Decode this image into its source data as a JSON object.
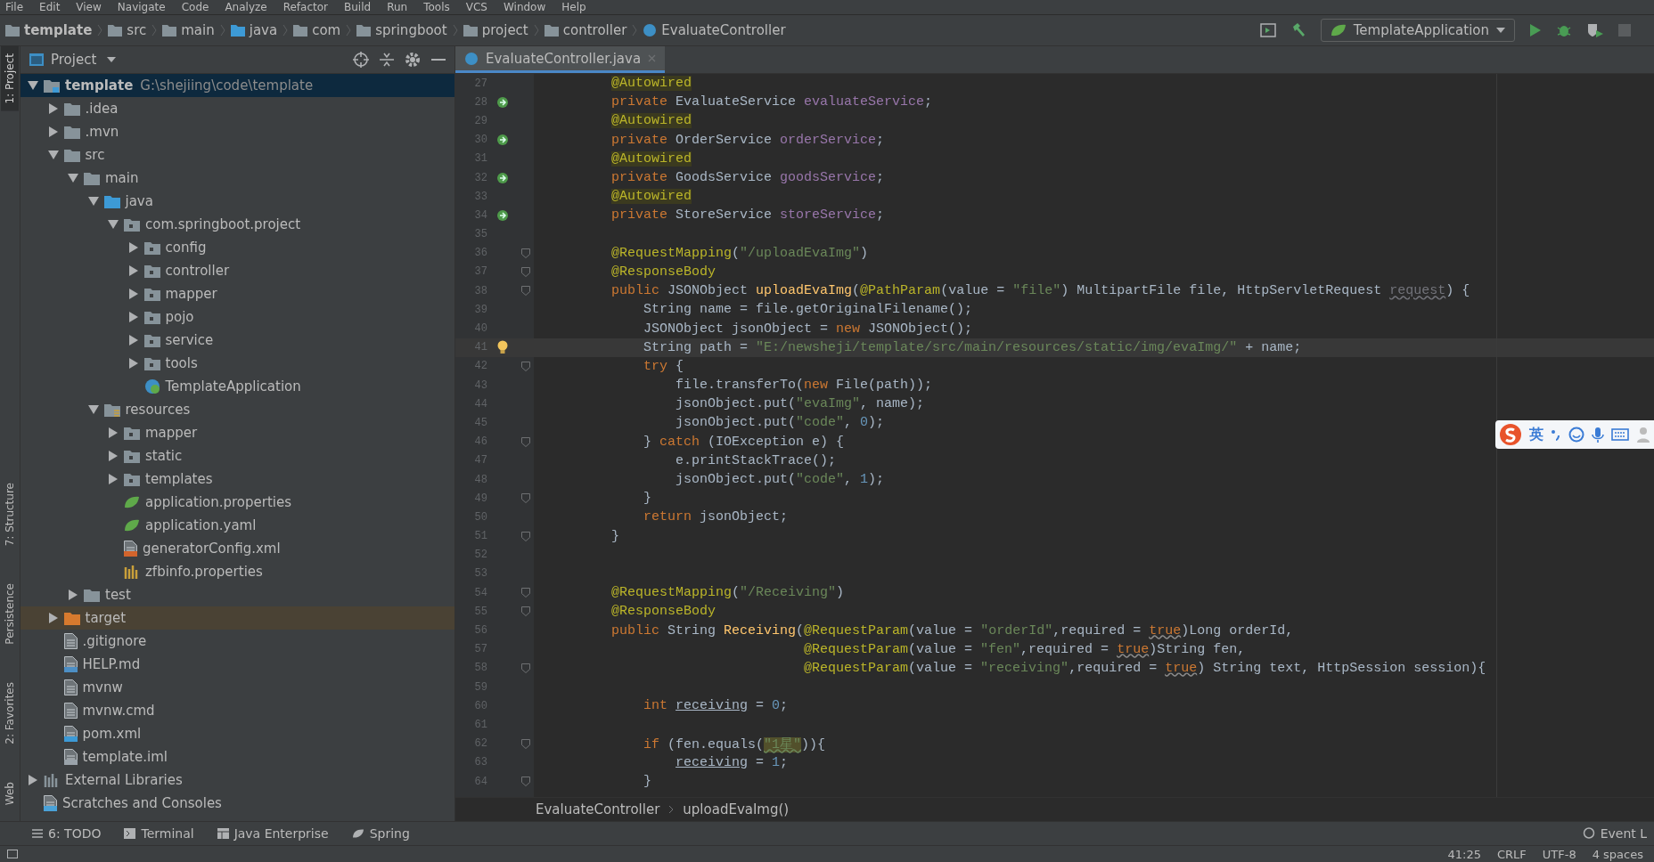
{
  "menu": [
    "File",
    "Edit",
    "View",
    "Navigate",
    "Code",
    "Analyze",
    "Refactor",
    "Build",
    "Run",
    "Tools",
    "VCS",
    "Window",
    "Help"
  ],
  "breadcrumb": [
    {
      "label": "template",
      "kind": "module"
    },
    {
      "label": "src",
      "kind": "folder"
    },
    {
      "label": "main",
      "kind": "folder"
    },
    {
      "label": "java",
      "kind": "source"
    },
    {
      "label": "com",
      "kind": "package"
    },
    {
      "label": "springboot",
      "kind": "package"
    },
    {
      "label": "project",
      "kind": "package"
    },
    {
      "label": "controller",
      "kind": "package"
    },
    {
      "label": "EvaluateController",
      "kind": "class"
    }
  ],
  "run_configuration": {
    "label": "TemplateApplication"
  },
  "side_tabs": [
    {
      "label": "1: Project",
      "selected": true
    },
    {
      "label": "7: Structure",
      "selected": false
    },
    {
      "label": "Persistence",
      "selected": false
    },
    {
      "label": "2: Favorites",
      "selected": false
    },
    {
      "label": "Web",
      "selected": false
    }
  ],
  "project_panel": {
    "title": "Project",
    "tree": [
      {
        "label": "template",
        "location": "G:\\shejiing\\code\\template",
        "kind": "module",
        "expanded": true,
        "selected": true,
        "children": [
          {
            "label": ".idea",
            "kind": "folder",
            "expanded": false,
            "selected": false
          },
          {
            "label": ".mvn",
            "kind": "folder",
            "expanded": false,
            "selected": false
          },
          {
            "label": "src",
            "kind": "folder",
            "expanded": true,
            "selected": false,
            "children": [
              {
                "label": "main",
                "kind": "folder",
                "expanded": true,
                "selected": false,
                "children": [
                  {
                    "label": "java",
                    "kind": "source",
                    "expanded": true,
                    "selected": false,
                    "children": [
                      {
                        "label": "com.springboot.project",
                        "kind": "package",
                        "expanded": true,
                        "selected": false,
                        "children": [
                          {
                            "label": "config",
                            "kind": "package",
                            "expanded": false,
                            "selected": false
                          },
                          {
                            "label": "controller",
                            "kind": "package",
                            "expanded": false,
                            "selected": false
                          },
                          {
                            "label": "mapper",
                            "kind": "package",
                            "expanded": false,
                            "selected": false
                          },
                          {
                            "label": "pojo",
                            "kind": "package",
                            "expanded": false,
                            "selected": false
                          },
                          {
                            "label": "service",
                            "kind": "package",
                            "expanded": false,
                            "selected": false
                          },
                          {
                            "label": "tools",
                            "kind": "package",
                            "expanded": false,
                            "selected": false
                          },
                          {
                            "label": "TemplateApplication",
                            "kind": "spring-class",
                            "selected": false
                          }
                        ]
                      }
                    ]
                  },
                  {
                    "label": "resources",
                    "kind": "resources",
                    "expanded": true,
                    "selected": false,
                    "children": [
                      {
                        "label": "mapper",
                        "kind": "package",
                        "expanded": false,
                        "selected": false
                      },
                      {
                        "label": "static",
                        "kind": "package",
                        "expanded": false,
                        "selected": false
                      },
                      {
                        "label": "templates",
                        "kind": "package",
                        "expanded": false,
                        "selected": false
                      },
                      {
                        "label": "application.properties",
                        "kind": "spring-config",
                        "selected": false
                      },
                      {
                        "label": "application.yaml",
                        "kind": "spring-config",
                        "selected": false
                      },
                      {
                        "label": "generatorConfig.xml",
                        "kind": "xml",
                        "selected": false
                      },
                      {
                        "label": "zfbinfo.properties",
                        "kind": "properties",
                        "selected": false
                      }
                    ]
                  }
                ]
              },
              {
                "label": "test",
                "kind": "folder",
                "expanded": false,
                "selected": false
              }
            ]
          },
          {
            "label": "target",
            "kind": "excluded",
            "expanded": false,
            "selected": false
          },
          {
            "label": ".gitignore",
            "kind": "file",
            "selected": false
          },
          {
            "label": "HELP.md",
            "kind": "markdown",
            "selected": false
          },
          {
            "label": "mvnw",
            "kind": "file",
            "selected": false
          },
          {
            "label": "mvnw.cmd",
            "kind": "file",
            "selected": false
          },
          {
            "label": "pom.xml",
            "kind": "maven",
            "selected": false
          },
          {
            "label": "template.iml",
            "kind": "iml",
            "selected": false
          }
        ]
      },
      {
        "label": "External Libraries",
        "kind": "libraries",
        "expanded": false,
        "selected": false
      },
      {
        "label": "Scratches and Consoles",
        "kind": "scratches",
        "selected": false
      }
    ]
  },
  "editor": {
    "tabs": [
      {
        "label": "EvaluateController.java",
        "selected": true
      }
    ],
    "lines": [
      {
        "number": "27",
        "tokens": [
          {
            "kind": "annotation-hl",
            "text": "    @Autowired"
          }
        ]
      },
      {
        "number": "28",
        "kind": "bean",
        "tokens": [
          {
            "kind": "keyword",
            "text": "    private "
          },
          {
            "kind": "plain",
            "text": "EvaluateService "
          },
          {
            "kind": "field",
            "text": "evaluateService"
          },
          {
            "kind": "plain",
            "text": ";"
          }
        ]
      },
      {
        "number": "29",
        "tokens": [
          {
            "kind": "annotation-hl",
            "text": "    @Autowired"
          }
        ]
      },
      {
        "number": "30",
        "kind": "bean",
        "tokens": [
          {
            "kind": "keyword",
            "text": "    private "
          },
          {
            "kind": "plain",
            "text": "OrderService "
          },
          {
            "kind": "field",
            "text": "orderService"
          },
          {
            "kind": "plain",
            "text": ";"
          }
        ]
      },
      {
        "number": "31",
        "tokens": [
          {
            "kind": "annotation-hl",
            "text": "    @Autowired"
          }
        ]
      },
      {
        "number": "32",
        "kind": "bean",
        "tokens": [
          {
            "kind": "keyword",
            "text": "    private "
          },
          {
            "kind": "plain",
            "text": "GoodsService "
          },
          {
            "kind": "field",
            "text": "goodsService"
          },
          {
            "kind": "plain",
            "text": ";"
          }
        ]
      },
      {
        "number": "33",
        "tokens": [
          {
            "kind": "annotation-hl",
            "text": "    @Autowired"
          }
        ]
      },
      {
        "number": "34",
        "kind": "bean",
        "tokens": [
          {
            "kind": "keyword",
            "text": "    private "
          },
          {
            "kind": "plain",
            "text": "StoreService "
          },
          {
            "kind": "field",
            "text": "storeService"
          },
          {
            "kind": "plain",
            "text": ";"
          }
        ]
      },
      {
        "number": "35"
      },
      {
        "number": "36",
        "kind": "fold",
        "tokens": [
          {
            "kind": "annotation",
            "text": "    @RequestMapping"
          },
          {
            "kind": "plain",
            "text": "("
          },
          {
            "kind": "string",
            "text": "\"/uploadEvaImg\""
          },
          {
            "kind": "plain",
            "text": ")"
          }
        ]
      },
      {
        "number": "37",
        "kind": "fold",
        "tokens": [
          {
            "kind": "annotation",
            "text": "    @ResponseBody"
          }
        ]
      },
      {
        "number": "38",
        "kind": "fold",
        "tokens": [
          {
            "kind": "keyword",
            "text": "    public "
          },
          {
            "kind": "plain",
            "text": "JSONObject "
          },
          {
            "kind": "method",
            "text": "uploadEvaImg"
          },
          {
            "kind": "plain",
            "text": "("
          },
          {
            "kind": "annotation",
            "text": "@PathParam"
          },
          {
            "kind": "plain",
            "text": "(value = "
          },
          {
            "kind": "string",
            "text": "\"file\""
          },
          {
            "kind": "plain",
            "text": ") MultipartFile file, HttpServletRequest "
          },
          {
            "kind": "unused",
            "text": "request"
          },
          {
            "kind": "plain",
            "text": ") {"
          }
        ]
      },
      {
        "number": "39",
        "tokens": [
          {
            "kind": "plain",
            "text": "        String name = file.getOriginalFilename();"
          }
        ]
      },
      {
        "number": "40",
        "tokens": [
          {
            "kind": "plain",
            "text": "        JSONObject jsonObject = "
          },
          {
            "kind": "keyword",
            "text": "new "
          },
          {
            "kind": "plain",
            "text": "JSONObject();"
          }
        ]
      },
      {
        "number": "41",
        "kind": "bulb",
        "current": true,
        "tokens": [
          {
            "kind": "plain",
            "text": "        String path = "
          },
          {
            "kind": "string",
            "text": "\"E:/newsheji/template/src/main/resources/static/img/evaImg/\""
          },
          {
            "kind": "plain",
            "text": " + name;"
          }
        ]
      },
      {
        "number": "42",
        "kind": "fold",
        "tokens": [
          {
            "kind": "keyword",
            "text": "        try"
          },
          {
            "kind": "plain",
            "text": " {"
          }
        ]
      },
      {
        "number": "43",
        "tokens": [
          {
            "kind": "plain",
            "text": "            file.transferTo("
          },
          {
            "kind": "keyword",
            "text": "new "
          },
          {
            "kind": "plain",
            "text": "File(path));"
          }
        ]
      },
      {
        "number": "44",
        "tokens": [
          {
            "kind": "plain",
            "text": "            jsonObject.put("
          },
          {
            "kind": "string",
            "text": "\"evaImg\""
          },
          {
            "kind": "plain",
            "text": ", name);"
          }
        ]
      },
      {
        "number": "45",
        "tokens": [
          {
            "kind": "plain",
            "text": "            jsonObject.put("
          },
          {
            "kind": "string",
            "text": "\"code\""
          },
          {
            "kind": "plain",
            "text": ", "
          },
          {
            "kind": "number",
            "text": "0"
          },
          {
            "kind": "plain",
            "text": ");"
          }
        ]
      },
      {
        "number": "46",
        "kind": "fold",
        "tokens": [
          {
            "kind": "plain",
            "text": "        } "
          },
          {
            "kind": "keyword",
            "text": "catch"
          },
          {
            "kind": "plain",
            "text": " (IOException e) {"
          }
        ]
      },
      {
        "number": "47",
        "tokens": [
          {
            "kind": "plain",
            "text": "            e.printStackTrace();"
          }
        ]
      },
      {
        "number": "48",
        "tokens": [
          {
            "kind": "plain",
            "text": "            jsonObject.put("
          },
          {
            "kind": "string",
            "text": "\"code\""
          },
          {
            "kind": "plain",
            "text": ", "
          },
          {
            "kind": "number",
            "text": "1"
          },
          {
            "kind": "plain",
            "text": ");"
          }
        ]
      },
      {
        "number": "49",
        "kind": "fold",
        "tokens": [
          {
            "kind": "plain",
            "text": "        }"
          }
        ]
      },
      {
        "number": "50",
        "tokens": [
          {
            "kind": "keyword",
            "text": "        return "
          },
          {
            "kind": "plain",
            "text": "jsonObject;"
          }
        ]
      },
      {
        "number": "51",
        "kind": "fold",
        "tokens": [
          {
            "kind": "plain",
            "text": "    }"
          }
        ]
      },
      {
        "number": "52"
      },
      {
        "number": "53"
      },
      {
        "number": "54",
        "kind": "fold",
        "tokens": [
          {
            "kind": "annotation",
            "text": "    @RequestMapping"
          },
          {
            "kind": "plain",
            "text": "("
          },
          {
            "kind": "string",
            "text": "\"/Receiving\""
          },
          {
            "kind": "plain",
            "text": ")"
          }
        ]
      },
      {
        "number": "55",
        "kind": "fold",
        "tokens": [
          {
            "kind": "annotation",
            "text": "    @ResponseBody"
          }
        ]
      },
      {
        "number": "56",
        "tokens": [
          {
            "kind": "keyword",
            "text": "    public "
          },
          {
            "kind": "plain",
            "text": "String "
          },
          {
            "kind": "method",
            "text": "Receiving"
          },
          {
            "kind": "plain",
            "text": "("
          },
          {
            "kind": "annotation",
            "text": "@RequestParam"
          },
          {
            "kind": "plain",
            "text": "(value = "
          },
          {
            "kind": "string",
            "text": "\"orderId\""
          },
          {
            "kind": "plain",
            "text": ",required = "
          },
          {
            "kind": "flagged-keyword",
            "text": "true"
          },
          {
            "kind": "plain",
            "text": ")Long orderId,"
          }
        ]
      },
      {
        "number": "57",
        "tokens": [
          {
            "kind": "annotation",
            "text": "                            @RequestParam"
          },
          {
            "kind": "plain",
            "text": "(value = "
          },
          {
            "kind": "string",
            "text": "\"fen\""
          },
          {
            "kind": "plain",
            "text": ",required = "
          },
          {
            "kind": "flagged-keyword",
            "text": "true"
          },
          {
            "kind": "plain",
            "text": ")String fen,"
          }
        ]
      },
      {
        "number": "58",
        "kind": "fold",
        "tokens": [
          {
            "kind": "annotation",
            "text": "                            @RequestParam"
          },
          {
            "kind": "plain",
            "text": "(value = "
          },
          {
            "kind": "string",
            "text": "\"receiving\""
          },
          {
            "kind": "plain",
            "text": ",required = "
          },
          {
            "kind": "flagged-keyword",
            "text": "true"
          },
          {
            "kind": "plain",
            "text": ") String text, HttpSession session){"
          }
        ]
      },
      {
        "number": "59"
      },
      {
        "number": "60",
        "tokens": [
          {
            "kind": "keyword",
            "text": "        int "
          },
          {
            "kind": "reassigned",
            "text": "receiving"
          },
          {
            "kind": "plain",
            "text": " = "
          },
          {
            "kind": "number",
            "text": "0"
          },
          {
            "kind": "plain",
            "text": ";"
          }
        ]
      },
      {
        "number": "61"
      },
      {
        "number": "62",
        "kind": "fold",
        "tokens": [
          {
            "kind": "keyword",
            "text": "        if"
          },
          {
            "kind": "plain",
            "text": " (fen.equals("
          },
          {
            "kind": "string-hl",
            "text": "\"1星\""
          },
          {
            "kind": "plain",
            "text": ")){"
          }
        ]
      },
      {
        "number": "63",
        "tokens": [
          {
            "kind": "reassigned",
            "text": "            receiving"
          },
          {
            "kind": "plain",
            "text": " = "
          },
          {
            "kind": "number",
            "text": "1"
          },
          {
            "kind": "plain",
            "text": ";"
          }
        ]
      },
      {
        "number": "64",
        "kind": "fold",
        "tokens": [
          {
            "kind": "plain",
            "text": "        }"
          }
        ]
      }
    ],
    "crumbs": [
      "EvaluateController",
      "uploadEvaImg()"
    ]
  },
  "ime_toolbar": {
    "language": "英"
  },
  "tool_tabs": [
    {
      "label": "6: TODO",
      "kind": "list"
    },
    {
      "label": "Terminal",
      "kind": "terminal"
    },
    {
      "label": "Java Enterprise",
      "kind": "enterprise"
    },
    {
      "label": "Spring",
      "kind": "leaf"
    }
  ],
  "event_log": "Event L",
  "status_bar": {
    "position": "41:25",
    "line_separator": "CRLF",
    "encoding": "UTF-8",
    "indent": "4 spaces"
  }
}
